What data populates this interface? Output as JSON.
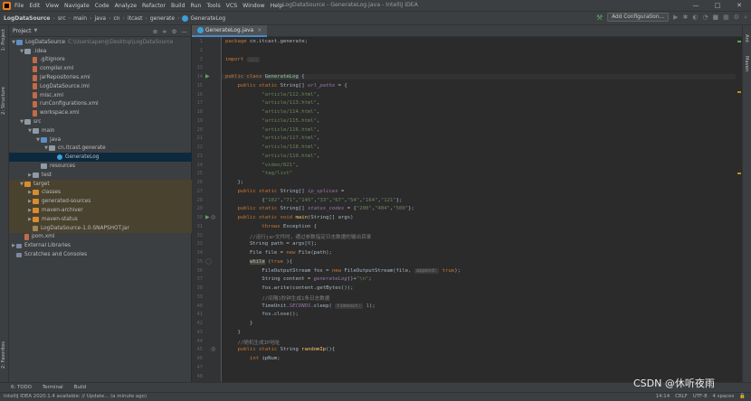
{
  "menubar": {
    "items": [
      "File",
      "Edit",
      "View",
      "Navigate",
      "Code",
      "Analyze",
      "Refactor",
      "Build",
      "Run",
      "Tools",
      "VCS",
      "Window",
      "Help"
    ],
    "window_title": "LogDataSource - GenerateLog.java - IntelliJ IDEA",
    "minimize": "—",
    "maximize": "□",
    "close": "✕"
  },
  "navbar": {
    "crumbs": [
      "LogDataSource",
      "src",
      "main",
      "java",
      "cn",
      "itcast",
      "generate",
      "GenerateLog"
    ],
    "add_config": "Add Configuration..."
  },
  "left_strip": {
    "project": "1: Project",
    "structure": "2: Structure",
    "favorites": "2: Favorites"
  },
  "right_strip": {
    "ant": "Ant",
    "maven": "Maven"
  },
  "project_panel": {
    "title": "Project",
    "tree": [
      {
        "label": "LogDataSource",
        "extra": "C:\\Users\\apeng\\Desktop\\LogDataSource",
        "indent": 0,
        "arrow": "▼",
        "icon": "f-blue"
      },
      {
        "label": ".idea",
        "indent": 1,
        "arrow": "▼",
        "icon": "f-folder"
      },
      {
        "label": ".gitignore",
        "indent": 2,
        "arrow": "",
        "icon": "f-file"
      },
      {
        "label": "compiler.xml",
        "indent": 2,
        "arrow": "",
        "icon": "f-file"
      },
      {
        "label": "jarRepositories.xml",
        "indent": 2,
        "arrow": "",
        "icon": "f-file"
      },
      {
        "label": "LogDataSource.iml",
        "indent": 2,
        "arrow": "",
        "icon": "f-file"
      },
      {
        "label": "misc.xml",
        "indent": 2,
        "arrow": "",
        "icon": "f-file"
      },
      {
        "label": "runConfigurations.xml",
        "indent": 2,
        "arrow": "",
        "icon": "f-file"
      },
      {
        "label": "workspace.xml",
        "indent": 2,
        "arrow": "",
        "icon": "f-file"
      },
      {
        "label": "src",
        "indent": 1,
        "arrow": "▼",
        "icon": "f-folder"
      },
      {
        "label": "main",
        "indent": 2,
        "arrow": "▼",
        "icon": "f-folder"
      },
      {
        "label": "java",
        "indent": 3,
        "arrow": "▼",
        "icon": "f-blue"
      },
      {
        "label": "cn.itcast.generate",
        "indent": 4,
        "arrow": "▼",
        "icon": "f-folder"
      },
      {
        "label": "GenerateLog",
        "indent": 5,
        "arrow": "",
        "icon": "f-cls",
        "selected": true
      },
      {
        "label": "resources",
        "indent": 3,
        "arrow": "",
        "icon": "f-folder"
      },
      {
        "label": "test",
        "indent": 2,
        "arrow": "▶",
        "icon": "f-folder"
      },
      {
        "label": "target",
        "indent": 1,
        "arrow": "▼",
        "icon": "f-orange",
        "target": true
      },
      {
        "label": "classes",
        "indent": 2,
        "arrow": "▶",
        "icon": "f-orange",
        "target": true
      },
      {
        "label": "generated-sources",
        "indent": 2,
        "arrow": "▶",
        "icon": "f-orange",
        "target": true
      },
      {
        "label": "maven-archiver",
        "indent": 2,
        "arrow": "▶",
        "icon": "f-orange",
        "target": true
      },
      {
        "label": "maven-status",
        "indent": 2,
        "arrow": "▶",
        "icon": "f-orange",
        "target": true
      },
      {
        "label": "LogDataSource-1.0-SNAPSHOT.jar",
        "indent": 2,
        "arrow": "",
        "icon": "f-jar",
        "target": true
      },
      {
        "label": "pom.xml",
        "indent": 1,
        "arrow": "",
        "icon": "f-file"
      },
      {
        "label": "External Libraries",
        "indent": 0,
        "arrow": "▶",
        "icon": "f-lib"
      },
      {
        "label": "Scratches and Consoles",
        "indent": 0,
        "arrow": "",
        "icon": "f-lib"
      }
    ]
  },
  "editor": {
    "tab": "GenerateLog.java",
    "line_numbers": [
      "1",
      "2",
      "3",
      "13",
      "14",
      "15",
      "16",
      "17",
      "18",
      "19",
      "20",
      "21",
      "22",
      "23",
      "24",
      "25",
      "26",
      "27",
      "28",
      "29",
      "30",
      "31",
      "32",
      "33",
      "34",
      "35",
      "36",
      "37",
      "38",
      "39",
      "40",
      "41",
      "42",
      "43",
      "44",
      "45",
      "46",
      "47",
      "48"
    ],
    "lines": [
      [
        [
          "kw",
          "package "
        ],
        [
          "",
          "cn.itcast.generate;"
        ]
      ],
      [],
      [
        [
          "kw",
          "import "
        ],
        [
          "hint",
          "..."
        ]
      ],
      [],
      [
        [
          "kw",
          "public class "
        ],
        [
          "cls-hl",
          "GenerateLog"
        ],
        [
          "",
          " {"
        ]
      ],
      [
        [
          "",
          "    "
        ],
        [
          "kw",
          "public static "
        ],
        [
          "",
          "String[] "
        ],
        [
          "fd",
          "url_paths"
        ],
        [
          "",
          " = {"
        ]
      ],
      [
        [
          "",
          "            "
        ],
        [
          "st",
          "\"article/112.html\""
        ],
        [
          "",
          ","
        ]
      ],
      [
        [
          "",
          "            "
        ],
        [
          "st",
          "\"article/113.html\""
        ],
        [
          "",
          ","
        ]
      ],
      [
        [
          "",
          "            "
        ],
        [
          "st",
          "\"article/114.html\""
        ],
        [
          "",
          ","
        ]
      ],
      [
        [
          "",
          "            "
        ],
        [
          "st",
          "\"article/115.html\""
        ],
        [
          "",
          ","
        ]
      ],
      [
        [
          "",
          "            "
        ],
        [
          "st",
          "\"article/116.html\""
        ],
        [
          "",
          ","
        ]
      ],
      [
        [
          "",
          "            "
        ],
        [
          "st",
          "\"article/117.html\""
        ],
        [
          "",
          ","
        ]
      ],
      [
        [
          "",
          "            "
        ],
        [
          "st",
          "\"article/118.html\""
        ],
        [
          "",
          ","
        ]
      ],
      [
        [
          "",
          "            "
        ],
        [
          "st",
          "\"article/119.html\""
        ],
        [
          "",
          ","
        ]
      ],
      [
        [
          "",
          "            "
        ],
        [
          "st",
          "\"video/821\""
        ],
        [
          "",
          ","
        ]
      ],
      [
        [
          "",
          "            "
        ],
        [
          "st",
          "\"tag/list\""
        ]
      ],
      [
        [
          "",
          "    };"
        ]
      ],
      [
        [
          "",
          "    "
        ],
        [
          "kw",
          "public static "
        ],
        [
          "",
          "String[] "
        ],
        [
          "fd",
          "ip_splices"
        ],
        [
          "",
          " ="
        ]
      ],
      [
        [
          "",
          "            {"
        ],
        [
          "st",
          "\"102\""
        ],
        [
          "",
          ","
        ],
        [
          "st",
          "\"71\""
        ],
        [
          "",
          ","
        ],
        [
          "st",
          "\"145\""
        ],
        [
          "",
          ","
        ],
        [
          "st",
          "\"33\""
        ],
        [
          "",
          ","
        ],
        [
          "st",
          "\"67\""
        ],
        [
          "",
          ","
        ],
        [
          "st",
          "\"54\""
        ],
        [
          "",
          ","
        ],
        [
          "st",
          "\"164\""
        ],
        [
          "",
          ","
        ],
        [
          "st",
          "\"121\""
        ],
        [
          "",
          "};"
        ]
      ],
      [
        [
          "",
          "    "
        ],
        [
          "kw",
          "public static "
        ],
        [
          "",
          "String[] "
        ],
        [
          "fd",
          "status_codes"
        ],
        [
          "",
          " = {"
        ],
        [
          "st",
          "\"200\""
        ],
        [
          "",
          ","
        ],
        [
          "st",
          "\"404\""
        ],
        [
          "",
          ","
        ],
        [
          "st",
          "\"500\""
        ],
        [
          "",
          "};"
        ]
      ],
      [
        [
          "",
          "    "
        ],
        [
          "kw",
          "public static void "
        ],
        [
          "fn",
          "main"
        ],
        [
          "",
          "(String[] args)"
        ]
      ],
      [
        [
          "",
          "            "
        ],
        [
          "kw",
          "throws "
        ],
        [
          "",
          "Exception {"
        ]
      ],
      [
        [
          "",
          "        "
        ],
        [
          "cm",
          "//运行jar文件时，通过参数指定日志数据的输出目录"
        ]
      ],
      [
        [
          "",
          "        String path = args["
        ],
        [
          "num",
          "0"
        ],
        [
          "",
          "];"
        ]
      ],
      [
        [
          "",
          "        File file = "
        ],
        [
          "kw",
          "new "
        ],
        [
          "",
          "File(path);"
        ]
      ],
      [
        [
          "",
          "        "
        ],
        [
          "vsel",
          "while"
        ],
        [
          "",
          " ("
        ],
        [
          "kw",
          "true"
        ],
        [
          "",
          " ){"
        ]
      ],
      [
        [
          "",
          "            FileOutputStream fos = "
        ],
        [
          "kw",
          "new "
        ],
        [
          "",
          "FileOutputStream(file, "
        ],
        [
          "hint",
          "append:"
        ],
        [
          "",
          " "
        ],
        [
          "kw",
          "true"
        ],
        [
          "",
          ");"
        ]
      ],
      [
        [
          "",
          "            String content = "
        ],
        [
          "sfield",
          "generateLog"
        ],
        [
          "",
          "()+"
        ],
        [
          "st",
          "\"\\n\""
        ],
        [
          "",
          ";"
        ]
      ],
      [
        [
          "",
          "            fos.write(content.getBytes());"
        ]
      ],
      [
        [
          "",
          "            "
        ],
        [
          "cm",
          "//间隔1秒钟生成1条日志数据"
        ]
      ],
      [
        [
          "",
          "            TimeUnit."
        ],
        [
          "sfield",
          "SECONDS"
        ],
        [
          "",
          ".sleep( "
        ],
        [
          "hint",
          "timeout:"
        ],
        [
          "",
          " "
        ],
        [
          "num",
          "1"
        ],
        [
          "",
          ");"
        ]
      ],
      [
        [
          "",
          "            fos.close();"
        ]
      ],
      [
        [
          "",
          "        }"
        ]
      ],
      [
        [
          "",
          "    }"
        ]
      ],
      [
        [
          "",
          "    "
        ],
        [
          "cm",
          "//随机生成IP地址"
        ]
      ],
      [
        [
          "",
          "    "
        ],
        [
          "kw",
          "public static "
        ],
        [
          "",
          "String "
        ],
        [
          "fn",
          "randomIp"
        ],
        [
          "",
          "(){"
        ]
      ],
      [
        [
          "",
          "        "
        ],
        [
          "kw",
          "int "
        ],
        [
          "",
          "ipNum;"
        ]
      ]
    ]
  },
  "bottom_tools": [
    "6: TODO",
    "Terminal",
    "Build"
  ],
  "status": {
    "left": "IntelliJ IDEA 2020.1.4 available: // Update... (a minute ago)",
    "right": [
      "14:14",
      "CRLF",
      "UTF-8",
      "4 spaces"
    ]
  },
  "watermark": "CSDN @休听夜雨"
}
